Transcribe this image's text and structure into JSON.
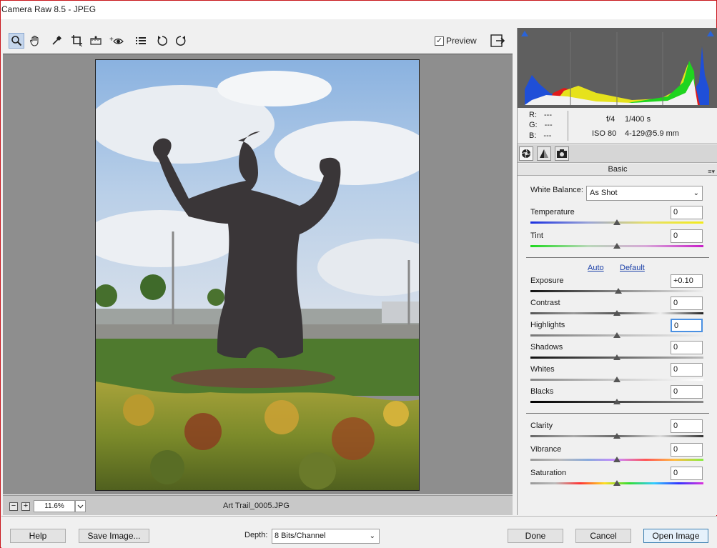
{
  "window": {
    "title": "Camera Raw 8.5  -  JPEG"
  },
  "toolbar": {
    "tools": [
      "zoom-tool-icon",
      "hand-tool-icon",
      "white-balance-tool-icon",
      "crop-tool-icon",
      "straighten-tool-icon",
      "red-eye-tool-icon",
      "preferences-icon",
      "rotate-left-icon",
      "rotate-right-icon"
    ],
    "preview_label": "Preview",
    "preview_checked": "✓"
  },
  "status": {
    "zoom_out": "−",
    "zoom_in": "+",
    "zoom_value": "11.6%",
    "filename": "Art Trail_0005.JPG"
  },
  "readout": {
    "r_label": "R:",
    "r_value": "---",
    "g_label": "G:",
    "g_value": "---",
    "b_label": "B:",
    "b_value": "---",
    "aperture": "f/4",
    "shutter": "1/400 s",
    "iso": "ISO 80",
    "lens": "4-129@5.9 mm"
  },
  "panel": {
    "title": "Basic",
    "white_balance_label": "White Balance:",
    "white_balance_value": "As Shot",
    "auto_link": "Auto",
    "default_link": "Default",
    "sliders": {
      "temperature": {
        "label": "Temperature",
        "value": "0"
      },
      "tint": {
        "label": "Tint",
        "value": "0"
      },
      "exposure": {
        "label": "Exposure",
        "value": "+0.10"
      },
      "contrast": {
        "label": "Contrast",
        "value": "0"
      },
      "highlights": {
        "label": "Highlights",
        "value": "0"
      },
      "shadows": {
        "label": "Shadows",
        "value": "0"
      },
      "whites": {
        "label": "Whites",
        "value": "0"
      },
      "blacks": {
        "label": "Blacks",
        "value": "0"
      },
      "clarity": {
        "label": "Clarity",
        "value": "0"
      },
      "vibrance": {
        "label": "Vibrance",
        "value": "0"
      },
      "saturation": {
        "label": "Saturation",
        "value": "0"
      }
    }
  },
  "bottom": {
    "help": "Help",
    "save_image": "Save Image...",
    "depth_label": "Depth:",
    "depth_value": "8 Bits/Channel",
    "done": "Done",
    "cancel": "Cancel",
    "open_image": "Open Image"
  },
  "colors": {
    "focus": "#4a90e2",
    "link": "#1a3fa8",
    "window_border": "#c8161c"
  }
}
